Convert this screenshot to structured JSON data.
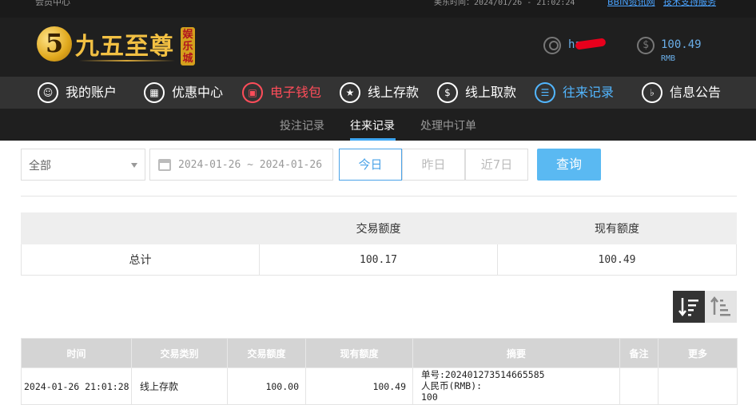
{
  "topbar": {
    "member_center": "会员中心",
    "beijing_time": "美东时间：2024/01/26 - 21:02:24",
    "link_bbin": "BBIN资讯网",
    "link_support": "技术支持服务"
  },
  "brand": {
    "logo_digit": "5",
    "name": "九五至尊",
    "sub": "娱乐城"
  },
  "account": {
    "username": "ha",
    "balance": "100.49",
    "currency": "RMB"
  },
  "main_nav": [
    {
      "label": "我的账户",
      "icon": "user-icon"
    },
    {
      "label": "优惠中心",
      "icon": "gift-icon"
    },
    {
      "label": "电子钱包",
      "icon": "wallet-icon"
    },
    {
      "label": "线上存款",
      "icon": "deposit-icon"
    },
    {
      "label": "线上取款",
      "icon": "withdraw-icon"
    },
    {
      "label": "往来记录",
      "icon": "records-icon"
    },
    {
      "label": "信息公告",
      "icon": "bell-icon"
    }
  ],
  "sub_nav": [
    {
      "label": "投注记录"
    },
    {
      "label": "往来记录"
    },
    {
      "label": "处理中订单"
    }
  ],
  "filters": {
    "type_selected": "全部",
    "date_start": "2024-01-26",
    "date_separator": "~",
    "date_end": "2024-01-26",
    "btn_today": "今日",
    "btn_yesterday": "昨日",
    "btn_last7": "近7日",
    "query": "查询"
  },
  "summary": {
    "col_amount": "交易额度",
    "col_balance": "现有额度",
    "row_label": "总计",
    "amount": "100.17",
    "balance": "100.49"
  },
  "records": {
    "headers": [
      "时间",
      "交易类别",
      "交易额度",
      "现有额度",
      "摘要",
      "备注",
      "更多"
    ],
    "rows": [
      {
        "time": "2024-01-26 21:01:28",
        "type": "线上存款",
        "amount": "100.00",
        "balance": "100.49",
        "memo_line1": "单号:202401273514665585",
        "memo_line2": "人民币(RMB):",
        "memo_line3": "100",
        "note": "",
        "more": ""
      }
    ]
  },
  "colors": {
    "accent_blue": "#4aa3e8",
    "wallet_red": "#ff4d5a",
    "query_button": "#5ab9f2",
    "gold": "#f2c043"
  }
}
